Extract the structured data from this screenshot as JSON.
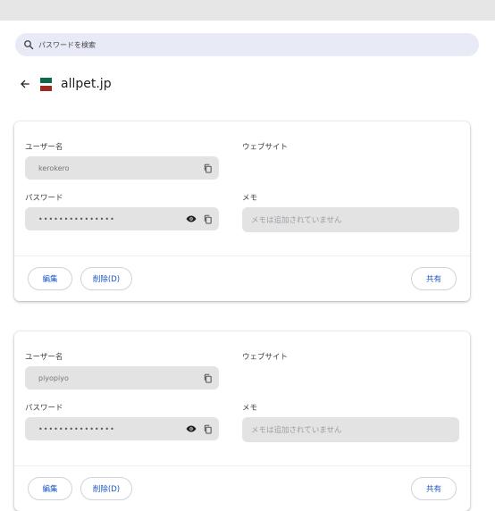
{
  "search": {
    "placeholder": "パスワードを検索"
  },
  "header": {
    "site": "allpet.jp"
  },
  "cards": [
    {
      "username_label": "ユーザー名",
      "username": "kerokero",
      "website_label": "ウェブサイト",
      "password_label": "パスワード",
      "password_mask": "•••••••••••••••",
      "note_label": "メモ",
      "note_placeholder": "メモは追加されていません",
      "edit": "編集",
      "delete": "削除(D)",
      "share": "共有"
    },
    {
      "username_label": "ユーザー名",
      "username": "piyopiyo",
      "website_label": "ウェブサイト",
      "password_label": "パスワード",
      "password_mask": "•••••••••••••••",
      "note_label": "メモ",
      "note_placeholder": "メモは追加されていません",
      "edit": "編集",
      "delete": "削除(D)",
      "share": "共有"
    }
  ]
}
